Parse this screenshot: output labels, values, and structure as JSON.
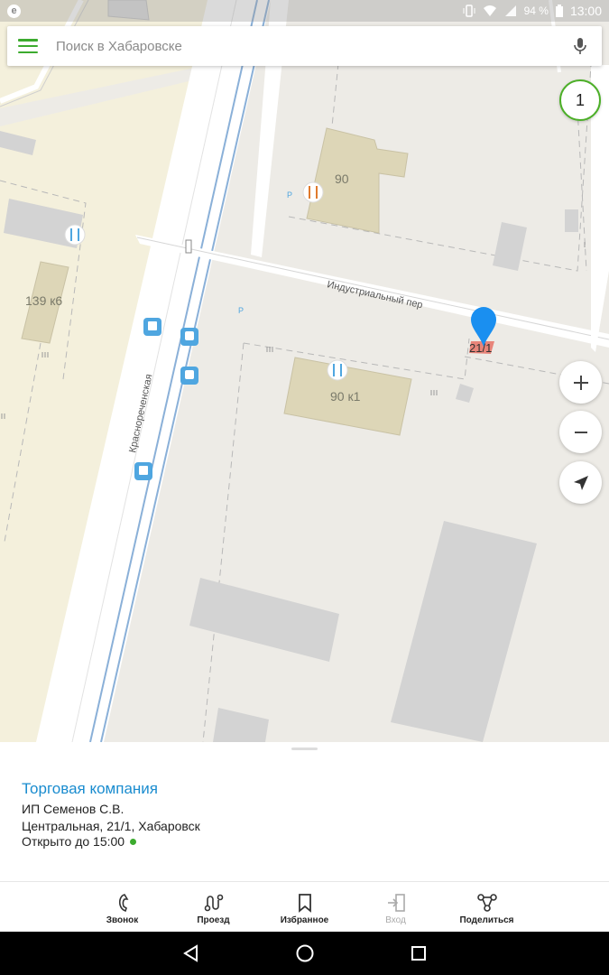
{
  "status": {
    "app_badge": "e",
    "battery": "94 %",
    "time": "13:00",
    "icons": [
      "vibrate-icon",
      "wifi-icon",
      "signal-icon"
    ]
  },
  "search": {
    "placeholder": "Поиск в Хабаровске"
  },
  "map": {
    "labels": {
      "street_industrial": "Индустриальный пер",
      "street_krasnorech": "Краснореченская",
      "building_90": "90",
      "building_90k1": "90 к1",
      "building_139k6": "139 к6",
      "marker_label": "21/1",
      "parking": "P"
    },
    "colors": {
      "background": "#edebe6",
      "residential": "#f4f0dc",
      "building": "#d9d9d9",
      "building_highlight": "#ddd6b7",
      "road": "#ffffff",
      "rail": "#8ab0d8",
      "marker": "#1a8ff0",
      "transit_icon": "#4fa6e0"
    }
  },
  "controls": {
    "layer_count": "1"
  },
  "place": {
    "title": "Торговая компания",
    "owner": "ИП Семенов С.В.",
    "address": "Центральная, 21/1, Хабаровск",
    "hours": "Открыто до 15:00"
  },
  "actions": [
    {
      "label": "Звонок",
      "icon": "phone-icon"
    },
    {
      "label": "Проезд",
      "icon": "route-icon"
    },
    {
      "label": "Избранное",
      "icon": "bookmark-icon"
    },
    {
      "label": "Вход",
      "icon": "entrance-icon"
    },
    {
      "label": "Поделиться",
      "icon": "share-icon"
    }
  ]
}
